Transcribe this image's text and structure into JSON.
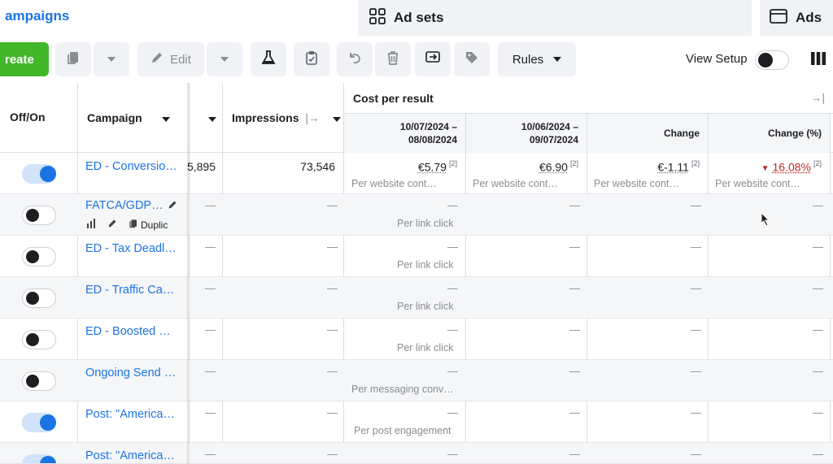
{
  "tabs": {
    "campaigns": "ampaigns",
    "adsets": "Ad sets",
    "ads": "Ads"
  },
  "toolbar": {
    "create_label": "reate",
    "edit_label": "Edit",
    "rules_label": "Rules",
    "view_setup_label": "View Setup"
  },
  "columns": {
    "offon": "Off/On",
    "campaign": "Campaign",
    "impressions": "Impressions",
    "cost_per_result": "Cost per result",
    "date1": "10/07/2024 –\n08/08/2024",
    "date1_a": "10/07/2024 –",
    "date1_b": "08/08/2024",
    "date2_a": "10/06/2024 –",
    "date2_b": "09/07/2024",
    "change": "Change",
    "change_pct": "Change (%)"
  },
  "rows": [
    {
      "on": true,
      "name": "ED - Conversio…",
      "results": "5,895",
      "impressions": "73,546",
      "cost1": "€5.79",
      "cost2": "€6.90",
      "change": "€-1.11",
      "change_pct": "16.08%",
      "note": "[2]",
      "sub1": "Per website cont…",
      "sub2": "Per website cont…",
      "sub3": "Per website cont…",
      "sub4": "Per website cont…"
    },
    {
      "on": false,
      "name": "FATCA/GDP…",
      "dash": "—",
      "sub": "Per link click",
      "actions": "Duplic"
    },
    {
      "on": false,
      "name": "ED - Tax Deadl…",
      "dash": "—",
      "sub": "Per link click"
    },
    {
      "on": false,
      "name": "ED - Traffic Ca…",
      "dash": "—",
      "sub": "Per link click"
    },
    {
      "on": false,
      "name": "ED - Boosted …",
      "dash": "—",
      "sub": "Per link click"
    },
    {
      "on": false,
      "name": "Ongoing Send …",
      "dash": "—",
      "sub": "Per messaging conv…"
    },
    {
      "on": true,
      "name": "Post: \"America…",
      "dash": "—",
      "sub": "Per post engagement"
    },
    {
      "on": true,
      "name": "Post: \"America…",
      "dash": "—",
      "sub": ""
    }
  ],
  "colors": {
    "accent": "#1b74e4",
    "create": "#42b72a",
    "negative": "#c02b2b"
  }
}
